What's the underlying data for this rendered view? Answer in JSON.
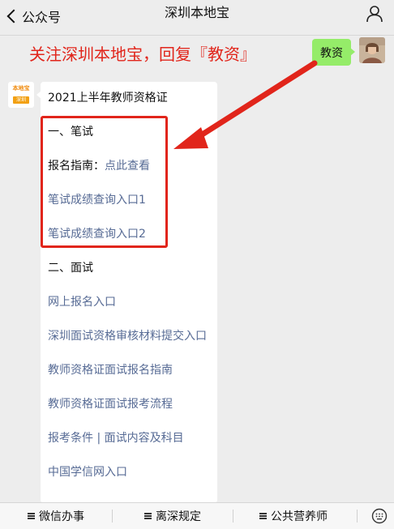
{
  "header": {
    "back_label": "公众号",
    "title": "深圳本地宝"
  },
  "promo": {
    "text": "关注深圳本地宝，回复『教资』",
    "color": "#e1251b"
  },
  "user_message": {
    "text": "教资",
    "bubble_color": "#95ec69"
  },
  "bot_avatar": {
    "logo_text": "本地宝",
    "logo_sub": "深圳"
  },
  "reply": {
    "heading": "2021上半年教师资格证",
    "written_section": "一、笔试",
    "signup_guide_label": "报名指南：",
    "signup_guide_link": "点此查看",
    "score_query_1": "笔试成绩查询入口1",
    "score_query_2": "笔试成绩查询入口2",
    "interview_section": "二、面试",
    "links": [
      "网上报名入口",
      "深圳面试资格审核材料提交入口",
      "教师资格证面试报名指南",
      "教师资格证面试报考流程",
      "报考条件 | 面试内容及科目",
      "中国学信网入口"
    ],
    "link_color": "#576b95"
  },
  "bottom_menu": {
    "items": [
      "微信办事",
      "离深规定",
      "公共营养师"
    ]
  }
}
